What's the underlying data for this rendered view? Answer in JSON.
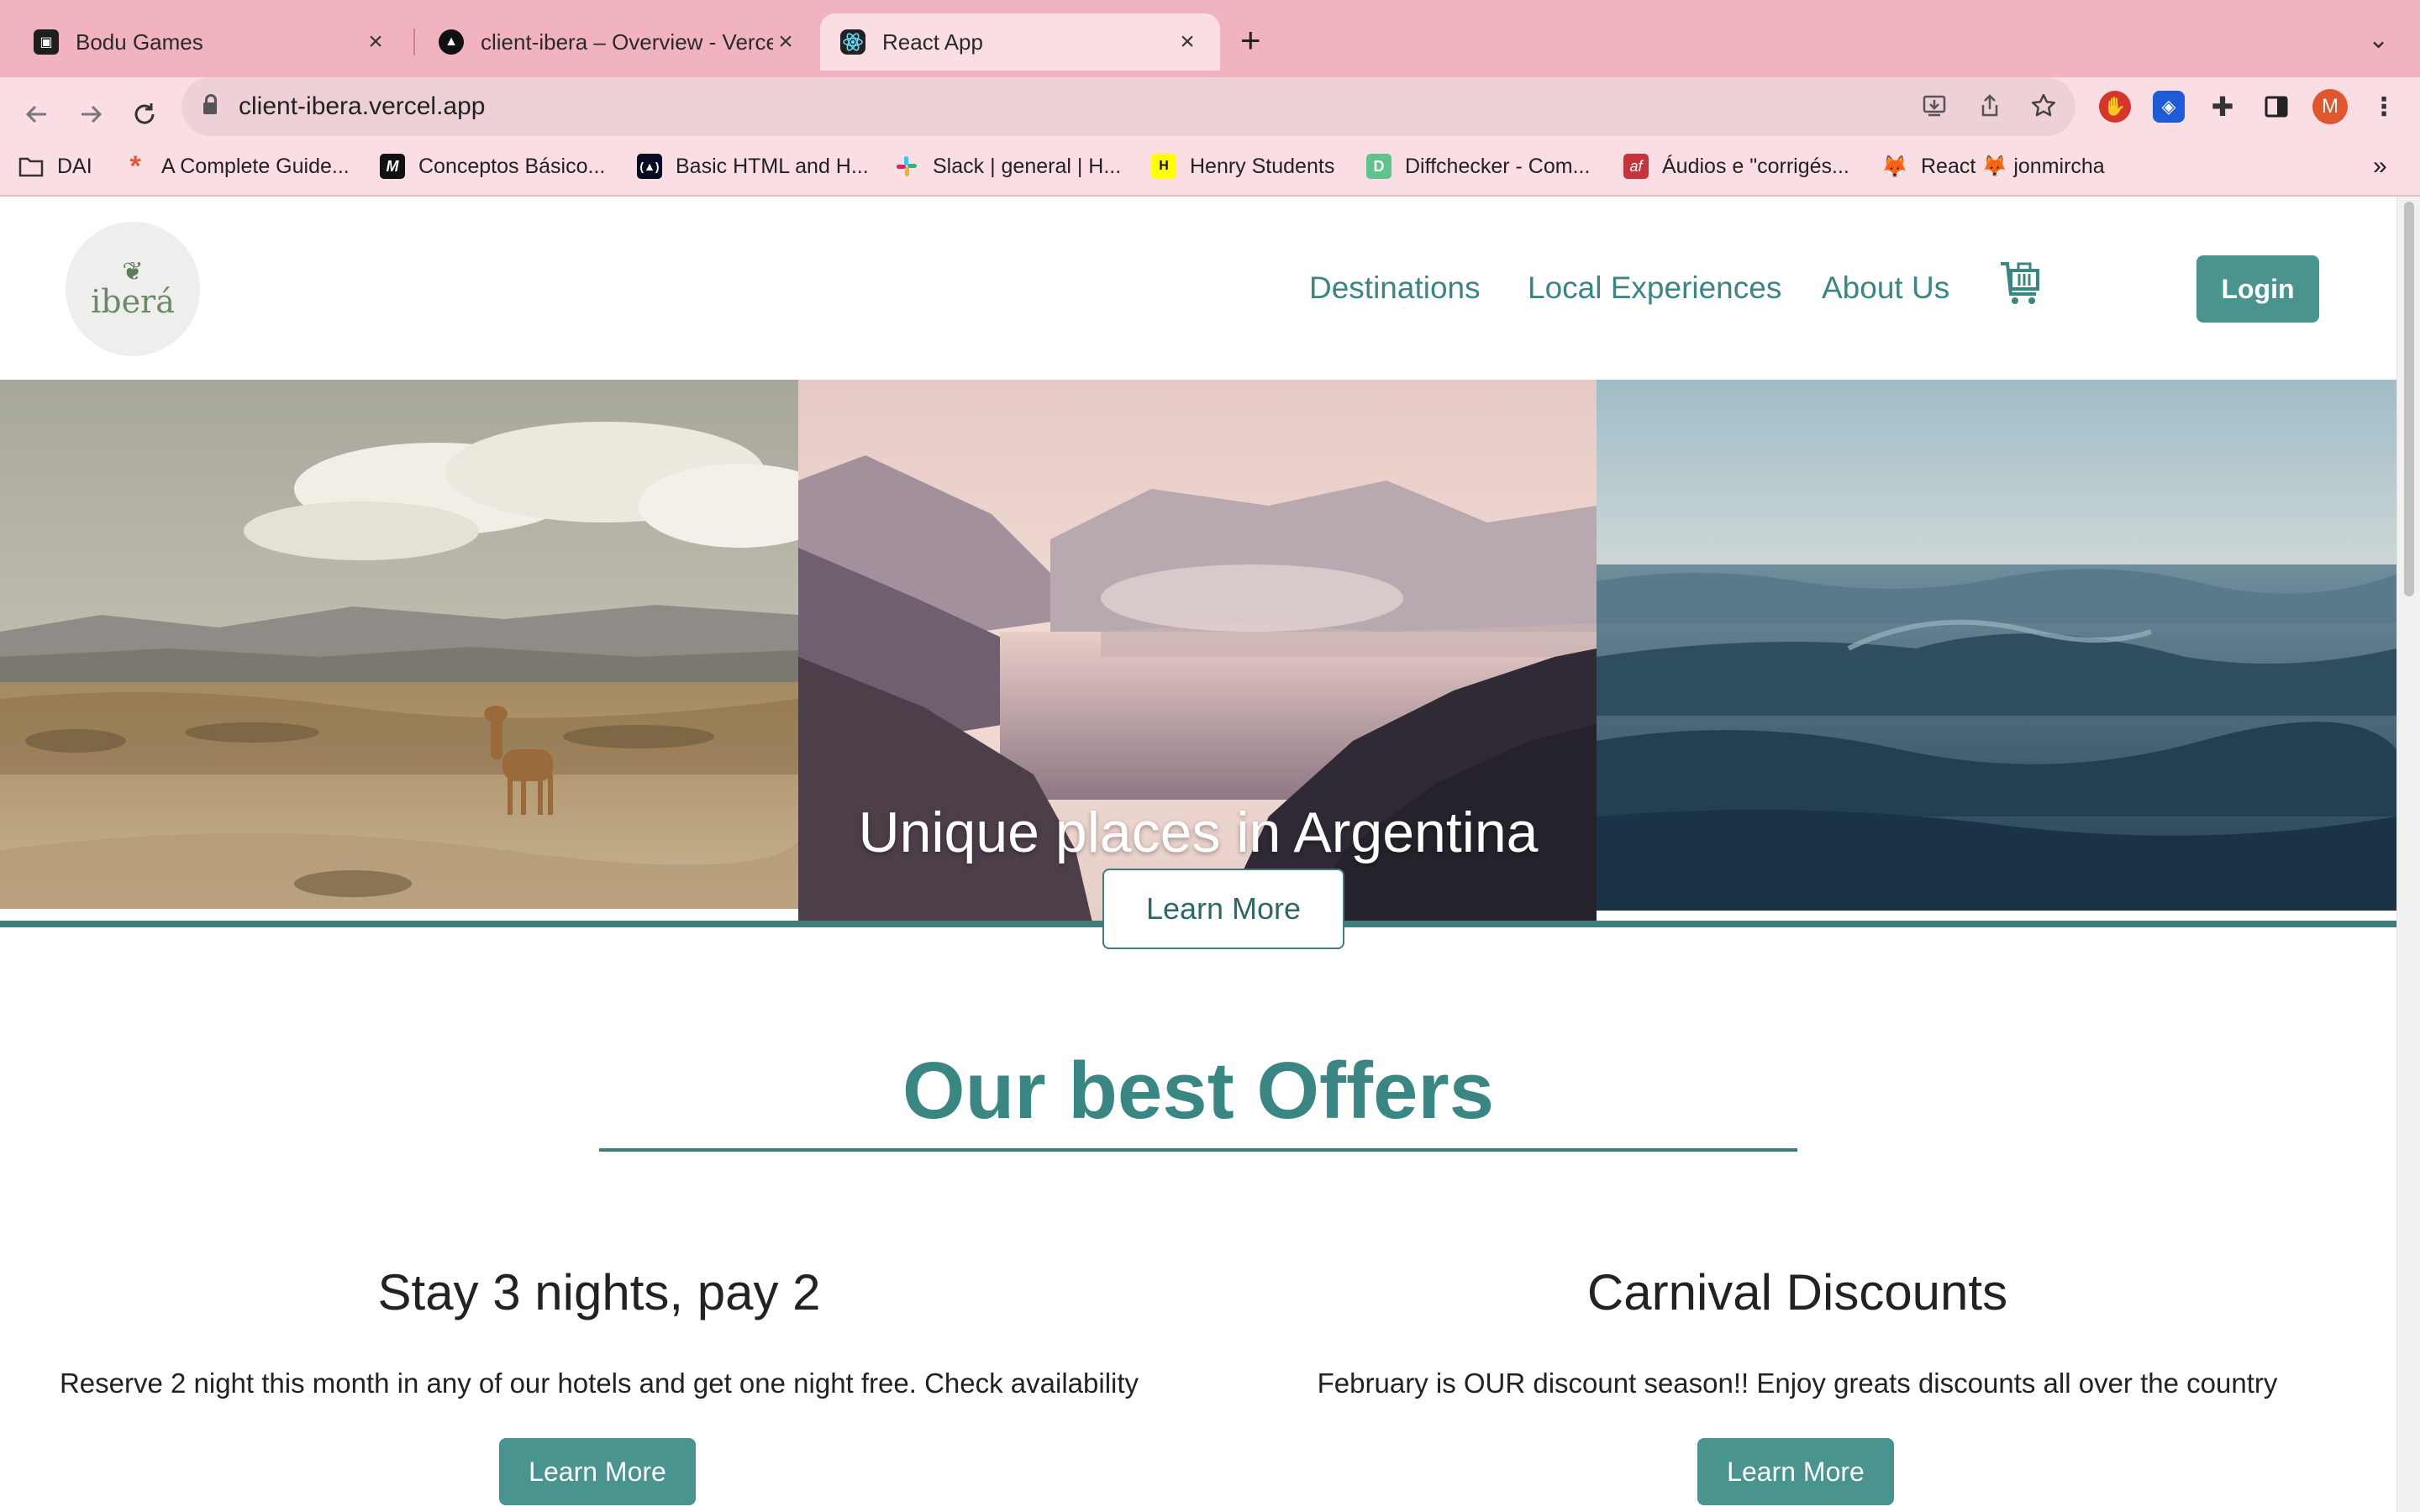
{
  "browser": {
    "tabs": [
      {
        "title": "Bodu Games",
        "active": false
      },
      {
        "title": "client-ibera – Overview - Vercel",
        "active": false
      },
      {
        "title": "React App",
        "active": true
      }
    ],
    "new_tab_glyph": "+",
    "close_glyph": "×",
    "url": "client-ibera.vercel.app",
    "profile_initial": "M",
    "bookmarks": [
      {
        "label": "DAI",
        "icon": "folder-icon"
      },
      {
        "label": "A Complete Guide...",
        "icon": "asterisk-icon"
      },
      {
        "label": "Conceptos Básico...",
        "icon": "m-logo-icon"
      },
      {
        "label": "Basic HTML and H...",
        "icon": "freecodecamp-icon"
      },
      {
        "label": "Slack | general | H...",
        "icon": "slack-icon"
      },
      {
        "label": "Henry Students",
        "icon": "henry-icon"
      },
      {
        "label": "Diffchecker - Com...",
        "icon": "diffchecker-icon"
      },
      {
        "label": "Áudios e \"corrigés...",
        "icon": "af-icon"
      },
      {
        "label": "React 🦊 jonmircha",
        "icon": "fox-icon"
      }
    ],
    "bookmarks_overflow": "»"
  },
  "site": {
    "logo_text": "iberá",
    "nav": {
      "destinations": "Destinations",
      "local_experiences": "Local Experiences",
      "about_us": "About Us",
      "login": "Login"
    },
    "hero": {
      "title": "Unique places in Argentina",
      "button": "Learn More"
    },
    "offers": {
      "heading": "Our best Offers",
      "items": [
        {
          "title": "Stay 3 nights, pay 2",
          "text": "Reserve 2 night this month in any of our hotels and get one night free. Check availability",
          "button": "Learn More"
        },
        {
          "title": "Carnival Discounts",
          "text": "February is OUR discount season!! Enjoy greats discounts all over the country",
          "button": "Learn More"
        }
      ]
    }
  },
  "colors": {
    "tabstrip": "#f2b3c0",
    "toolbar": "#fbdde4",
    "brand_teal": "#3a8683",
    "button_teal": "#4a9490"
  }
}
